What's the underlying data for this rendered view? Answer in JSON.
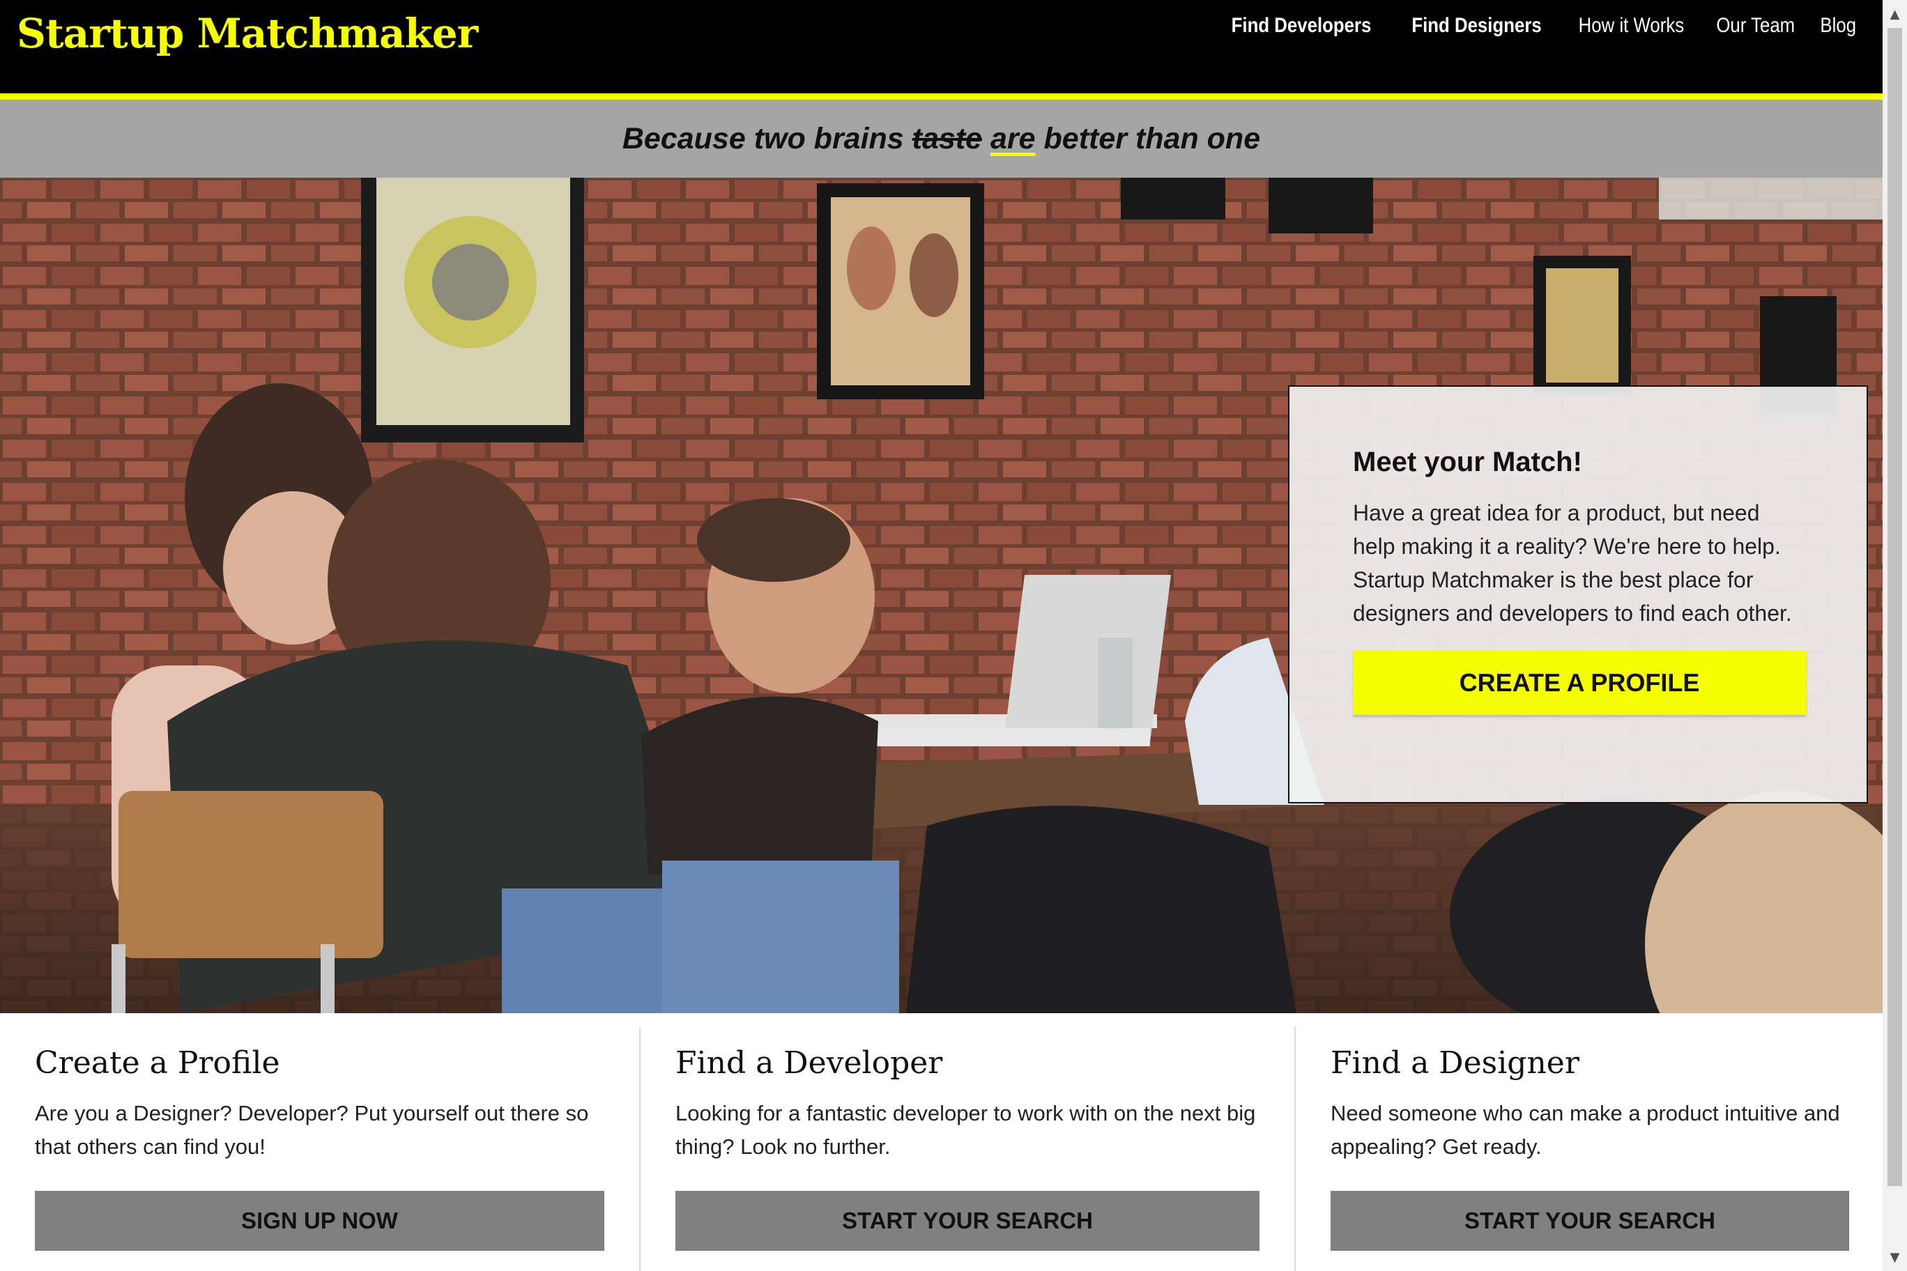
{
  "header": {
    "logo": "Startup Matchmaker",
    "nav": [
      {
        "label": "Find Developers",
        "bold": true
      },
      {
        "label": "Find Designers",
        "bold": true
      },
      {
        "label": "How it Works",
        "bold": false
      },
      {
        "label": "Our Team",
        "bold": false
      },
      {
        "label": "Blog",
        "bold": false
      }
    ]
  },
  "tagline": {
    "before": "Because two brains ",
    "struck": "taste",
    "underlined": "are",
    "after": " better than one"
  },
  "hero": {
    "image_description_icon": "coworking-photo",
    "card": {
      "title": "Meet your Match!",
      "body": "Have a great idea for a product, but need help making it a reality? We're here to help. Startup Matchmaker is the best place for designers and developers to find each other.",
      "cta": "CREATE A PROFILE"
    }
  },
  "features": [
    {
      "title": "Create a Profile",
      "body": "Are you a Designer? Developer? Put yourself out there so that others can find you!",
      "button": "SIGN UP NOW"
    },
    {
      "title": "Find a Developer",
      "body": "Looking for a fantastic developer to work with on the next big thing? Look no further.",
      "button": "START YOUR SEARCH"
    },
    {
      "title": "Find a Designer",
      "body": "Need someone who can make a product intuitive and appealing? Get ready.",
      "button": "START YOUR SEARCH"
    }
  ],
  "colors": {
    "accent": "#f5ff00",
    "header_bg": "#000000",
    "tagline_bg": "#a5a5a5",
    "button_gray": "#808080"
  }
}
